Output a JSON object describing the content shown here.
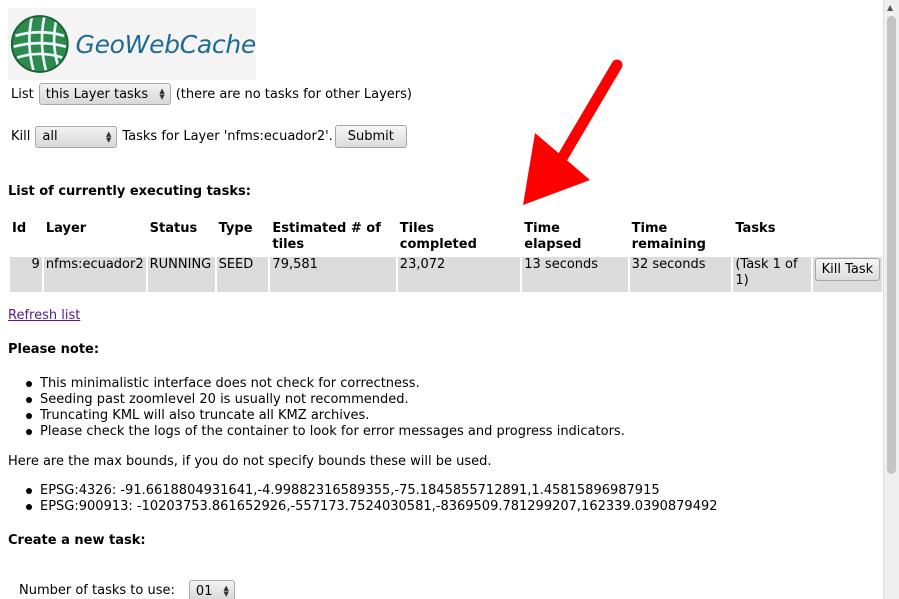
{
  "logo": {
    "text": "GeoWebCache"
  },
  "list_row": {
    "label": "List",
    "select_value": "this Layer tasks",
    "note": "(there are no tasks for other Layers)"
  },
  "kill_row": {
    "label": "Kill",
    "select_value": "all",
    "text": "Tasks for Layer 'nfms:ecuador2'.",
    "submit_label": "Submit"
  },
  "tasks_heading": "List of currently executing tasks:",
  "table": {
    "headers": {
      "id": "Id",
      "layer": "Layer",
      "status": "Status",
      "type": "Type",
      "est_line1": "Estimated # of",
      "est_line2": "tiles",
      "tiles_line1": "Tiles",
      "tiles_line2": "completed",
      "elapsed_line1": "Time",
      "elapsed_line2": "elapsed",
      "remaining_line1": "Time",
      "remaining_line2": "remaining",
      "tasks": "Tasks"
    },
    "rows": [
      {
        "id": "9",
        "layer": "nfms:ecuador2",
        "status": "RUNNING",
        "type": "SEED",
        "estimated": "79,581",
        "completed": "23,072",
        "elapsed": "13 seconds",
        "remaining": "32 seconds",
        "tasks_line1": "(Task 1 of",
        "tasks_line2": "1)",
        "kill_label": "Kill Task"
      }
    ]
  },
  "refresh_link": "Refresh list",
  "note_heading": "Please note:",
  "notes": [
    "This minimalistic interface does not check for correctness.",
    "Seeding past zoomlevel 20 is usually not recommended.",
    "Truncating KML will also truncate all KMZ archives.",
    "Please check the logs of the container to look for error messages and progress indicators."
  ],
  "bounds_intro": "Here are the max bounds, if you do not specify bounds these will be used.",
  "bounds": [
    "EPSG:4326: -91.6618804931641,-4.99882316589355,-75.1845855712891,1.45815896987915",
    "EPSG:900913: -10203753.861652926,-557173.7524030581,-8369509.781299207,162339.0390879492"
  ],
  "create_heading": "Create a new task:",
  "num_tasks": {
    "label": "Number of tasks to use:",
    "value": "01"
  },
  "colors": {
    "arrow": "#ff0000",
    "row_bg": "#dcdcdc",
    "link": "#551a8b",
    "logo_text": "#1e6b8f"
  }
}
